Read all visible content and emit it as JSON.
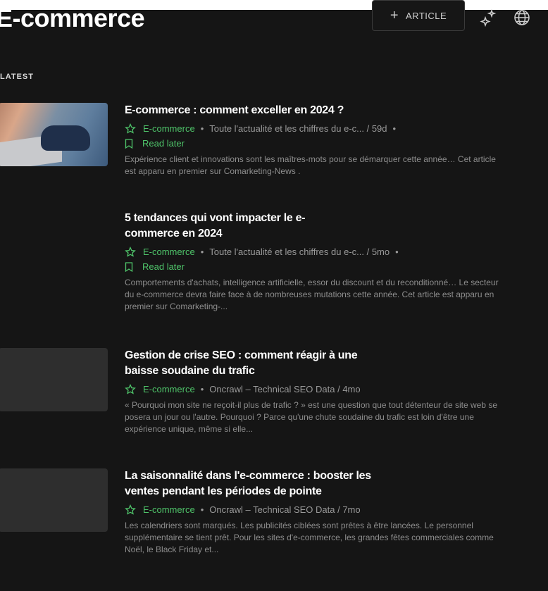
{
  "header": {
    "title": "E-commerce",
    "add_article_label": "ARTICLE",
    "icons": {
      "add": "plus-icon",
      "sparkle": "sparkle-icon",
      "language": "globe-icon"
    }
  },
  "section_label": "LATEST",
  "colors": {
    "accent": "#4fc56a",
    "background": "#151515"
  },
  "articles": [
    {
      "title": "E-commerce : comment exceller en 2024 ?",
      "category": "E-commerce",
      "source": "Toute l'actualité et les chiffres du e-c... / 59d",
      "trailing_dot": "•",
      "read_later": "Read later",
      "excerpt": "Expérience client et innovations sont les maîtres-mots pour se démarquer cette année… Cet article est apparu en premier sur Comarketing-News ."
    },
    {
      "title": "5 tendances qui vont impacter le e-commerce en 2024",
      "category": "E-commerce",
      "source": "Toute l'actualité et les chiffres du e-c... / 5mo",
      "trailing_dot": "•",
      "read_later": "Read later",
      "excerpt": "Comportements d'achats, intelligence artificielle, essor du discount et du reconditionné… Le secteur du e-commerce devra faire face à de nombreuses mutations cette année. Cet article est apparu en premier sur Comarketing-..."
    },
    {
      "title": "Gestion de crise SEO : comment réagir à une baisse soudaine du trafic",
      "category": "E-commerce",
      "source": "Oncrawl – Technical SEO Data / 4mo",
      "excerpt": "« Pourquoi mon site ne reçoit-il plus de trafic ? » est une question que tout détenteur de site web se posera un jour ou l'autre. Pourquoi ? Parce qu'une chute soudaine du trafic est loin d'être une expérience unique, même si elle..."
    },
    {
      "title": "La saisonnalité dans l'e-commerce : booster les ventes pendant les périodes de pointe",
      "category": "E-commerce",
      "source": "Oncrawl – Technical SEO Data / 7mo",
      "excerpt": "Les calendriers sont marqués. Les publicités ciblées sont prêtes à être lancées. Le personnel supplémentaire se tient prêt. Pour les sites d'e-commerce, les grandes fêtes commerciales comme Noël, le Black Friday et..."
    }
  ]
}
